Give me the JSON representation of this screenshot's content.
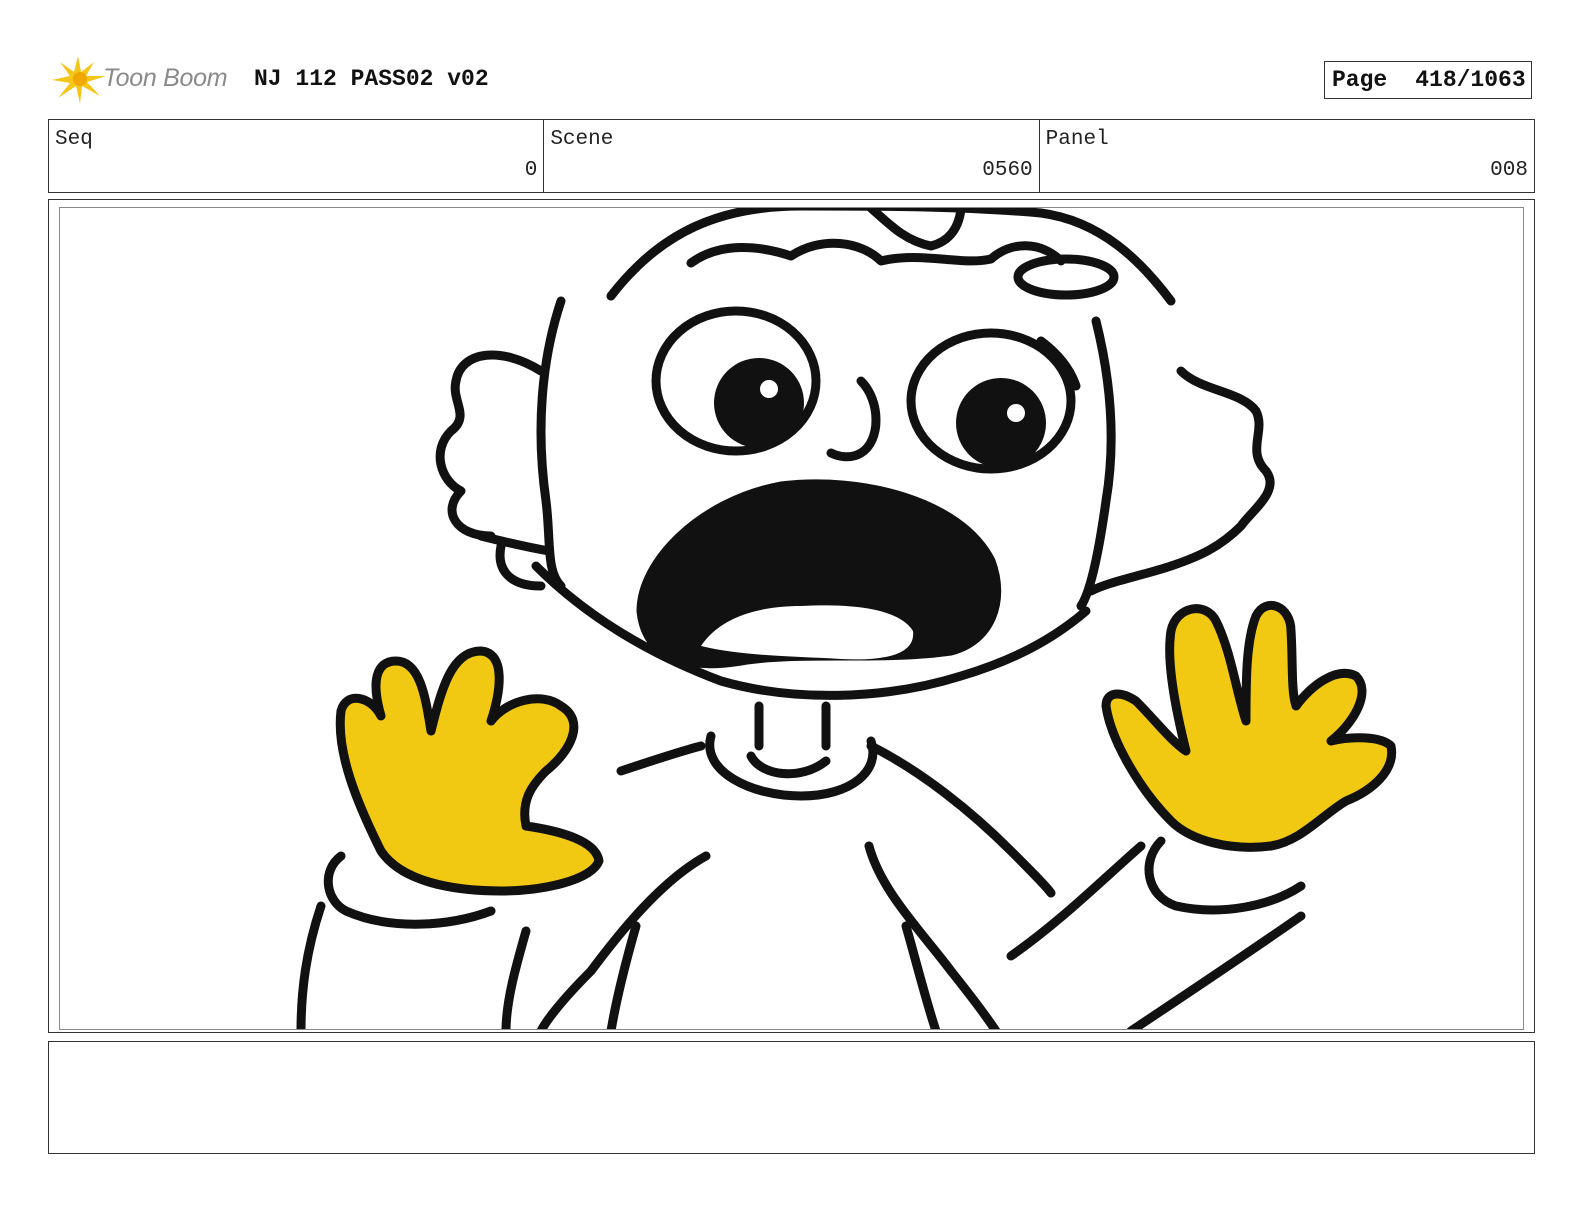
{
  "header": {
    "logo_text": "Toon Boom",
    "project_title": "NJ 112 PASS02 v02",
    "page_label": "Page",
    "page_number": "418/1063"
  },
  "info": {
    "seq_label": "Seq",
    "seq_value": "0",
    "scene_label": "Scene",
    "scene_value": "0560",
    "panel_label": "Panel",
    "panel_value": "008"
  },
  "notes": {
    "text": ""
  },
  "colors": {
    "hand_fill": "#f2c912",
    "logo_star": "#f5c518",
    "ink": "#111111"
  }
}
